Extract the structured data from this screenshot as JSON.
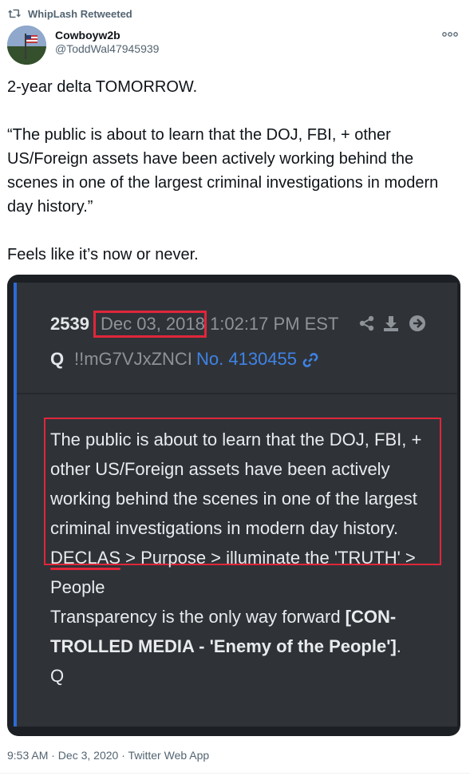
{
  "retweet": {
    "label": "WhipLash Retweeted",
    "icon": "retweet-icon"
  },
  "author": {
    "display_name": "Cowboyw2b",
    "handle": "@ToddWal47945939",
    "more_icon": "more-icon"
  },
  "tweet": {
    "line1": "2-year delta TOMORROW.",
    "quote": "“The public is about to learn that the DOJ, FBI, + other US/Foreign assets have been actively working behind the scenes in one of the largest criminal investigations in modern day history.”",
    "line3": "Feels like it’s now or never."
  },
  "q_post": {
    "number": "2539",
    "date": "Dec 03, 2018",
    "time": "1:02:17 PM EST",
    "name": "Q",
    "tripcode": "!!mG7VJxZNCI",
    "post_link": "No. 4130455",
    "icons": [
      "share-icon",
      "download-icon",
      "arrow-right-icon",
      "link-icon"
    ],
    "highlight_text": "The public is about to learn that the DOJ, FBI, + other US/Foreign assets have been actively working behind the scenes in one of the largest criminal investigations in modern day history.",
    "declas": "DECLAS",
    "purpose_line": " > Purpose > illuminate the 'TRUTH' > People",
    "transparency_text": "Transparency is the only way forward ",
    "transparency_bold": "[CON-TROLLED MEDIA - 'Enemy of the People']",
    "transparency_end": ".",
    "signature": "Q",
    "accent_color": "#e0263a",
    "bar_color": "#2d6bd6"
  },
  "footer": {
    "timestamp": "9:53 AM · Dec 3, 2020 · Twitter Web App"
  }
}
